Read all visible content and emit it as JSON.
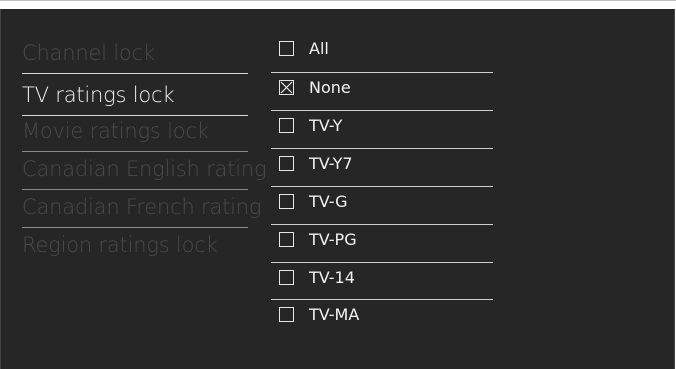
{
  "menu": {
    "items": [
      {
        "label": "Channel lock",
        "selected": false
      },
      {
        "label": "TV ratings lock",
        "selected": true
      },
      {
        "label": "Movie ratings lock",
        "selected": false
      },
      {
        "label": "Canadian English rating",
        "selected": false
      },
      {
        "label": "Canadian French rating",
        "selected": false
      },
      {
        "label": "Region ratings lock",
        "selected": false
      }
    ]
  },
  "options": {
    "items": [
      {
        "label": "All",
        "checked": false
      },
      {
        "label": "None",
        "checked": true
      },
      {
        "label": "TV-Y",
        "checked": false
      },
      {
        "label": "TV-Y7",
        "checked": false
      },
      {
        "label": "TV-G",
        "checked": false
      },
      {
        "label": "TV-PG",
        "checked": false
      },
      {
        "label": "TV-14",
        "checked": false
      },
      {
        "label": "TV-MA",
        "checked": false
      }
    ]
  },
  "colors": {
    "background": "#262626",
    "selected_text": "#f2f2f2",
    "dim_text": "#4a4a4a"
  }
}
